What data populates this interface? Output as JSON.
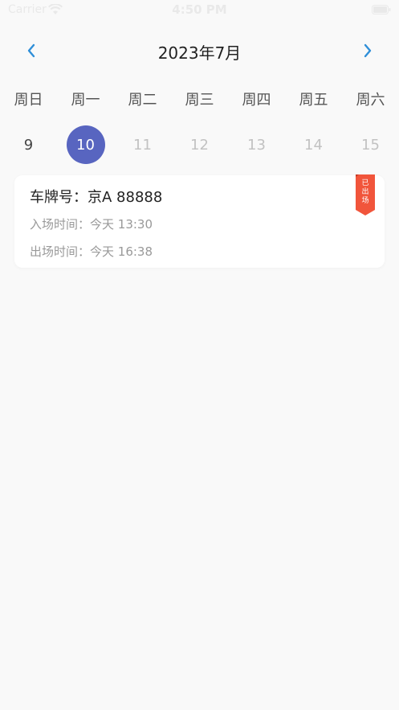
{
  "status_bar": {
    "carrier": "Carrier",
    "time": "4:50 PM"
  },
  "calendar": {
    "month_title": "2023年7月",
    "weekdays": [
      "周日",
      "周一",
      "周二",
      "周三",
      "周四",
      "周五",
      "周六"
    ],
    "days": [
      "9",
      "10",
      "11",
      "12",
      "13",
      "14",
      "15"
    ],
    "selected_day": "10",
    "prev_icon": "chevron-left-icon",
    "next_icon": "chevron-right-icon"
  },
  "record": {
    "plate_label": "车牌号：",
    "plate_value": "京A 88888",
    "entry_label": "入场时间：",
    "entry_value": "今天 13:30",
    "exit_label": "出场时间：",
    "exit_value": "今天 16:38",
    "status": "已出场"
  },
  "colors": {
    "accent": "#2f8fd8",
    "selected": "#5865c0",
    "ribbon": "#f1553b",
    "background": "#f9f9f9"
  }
}
